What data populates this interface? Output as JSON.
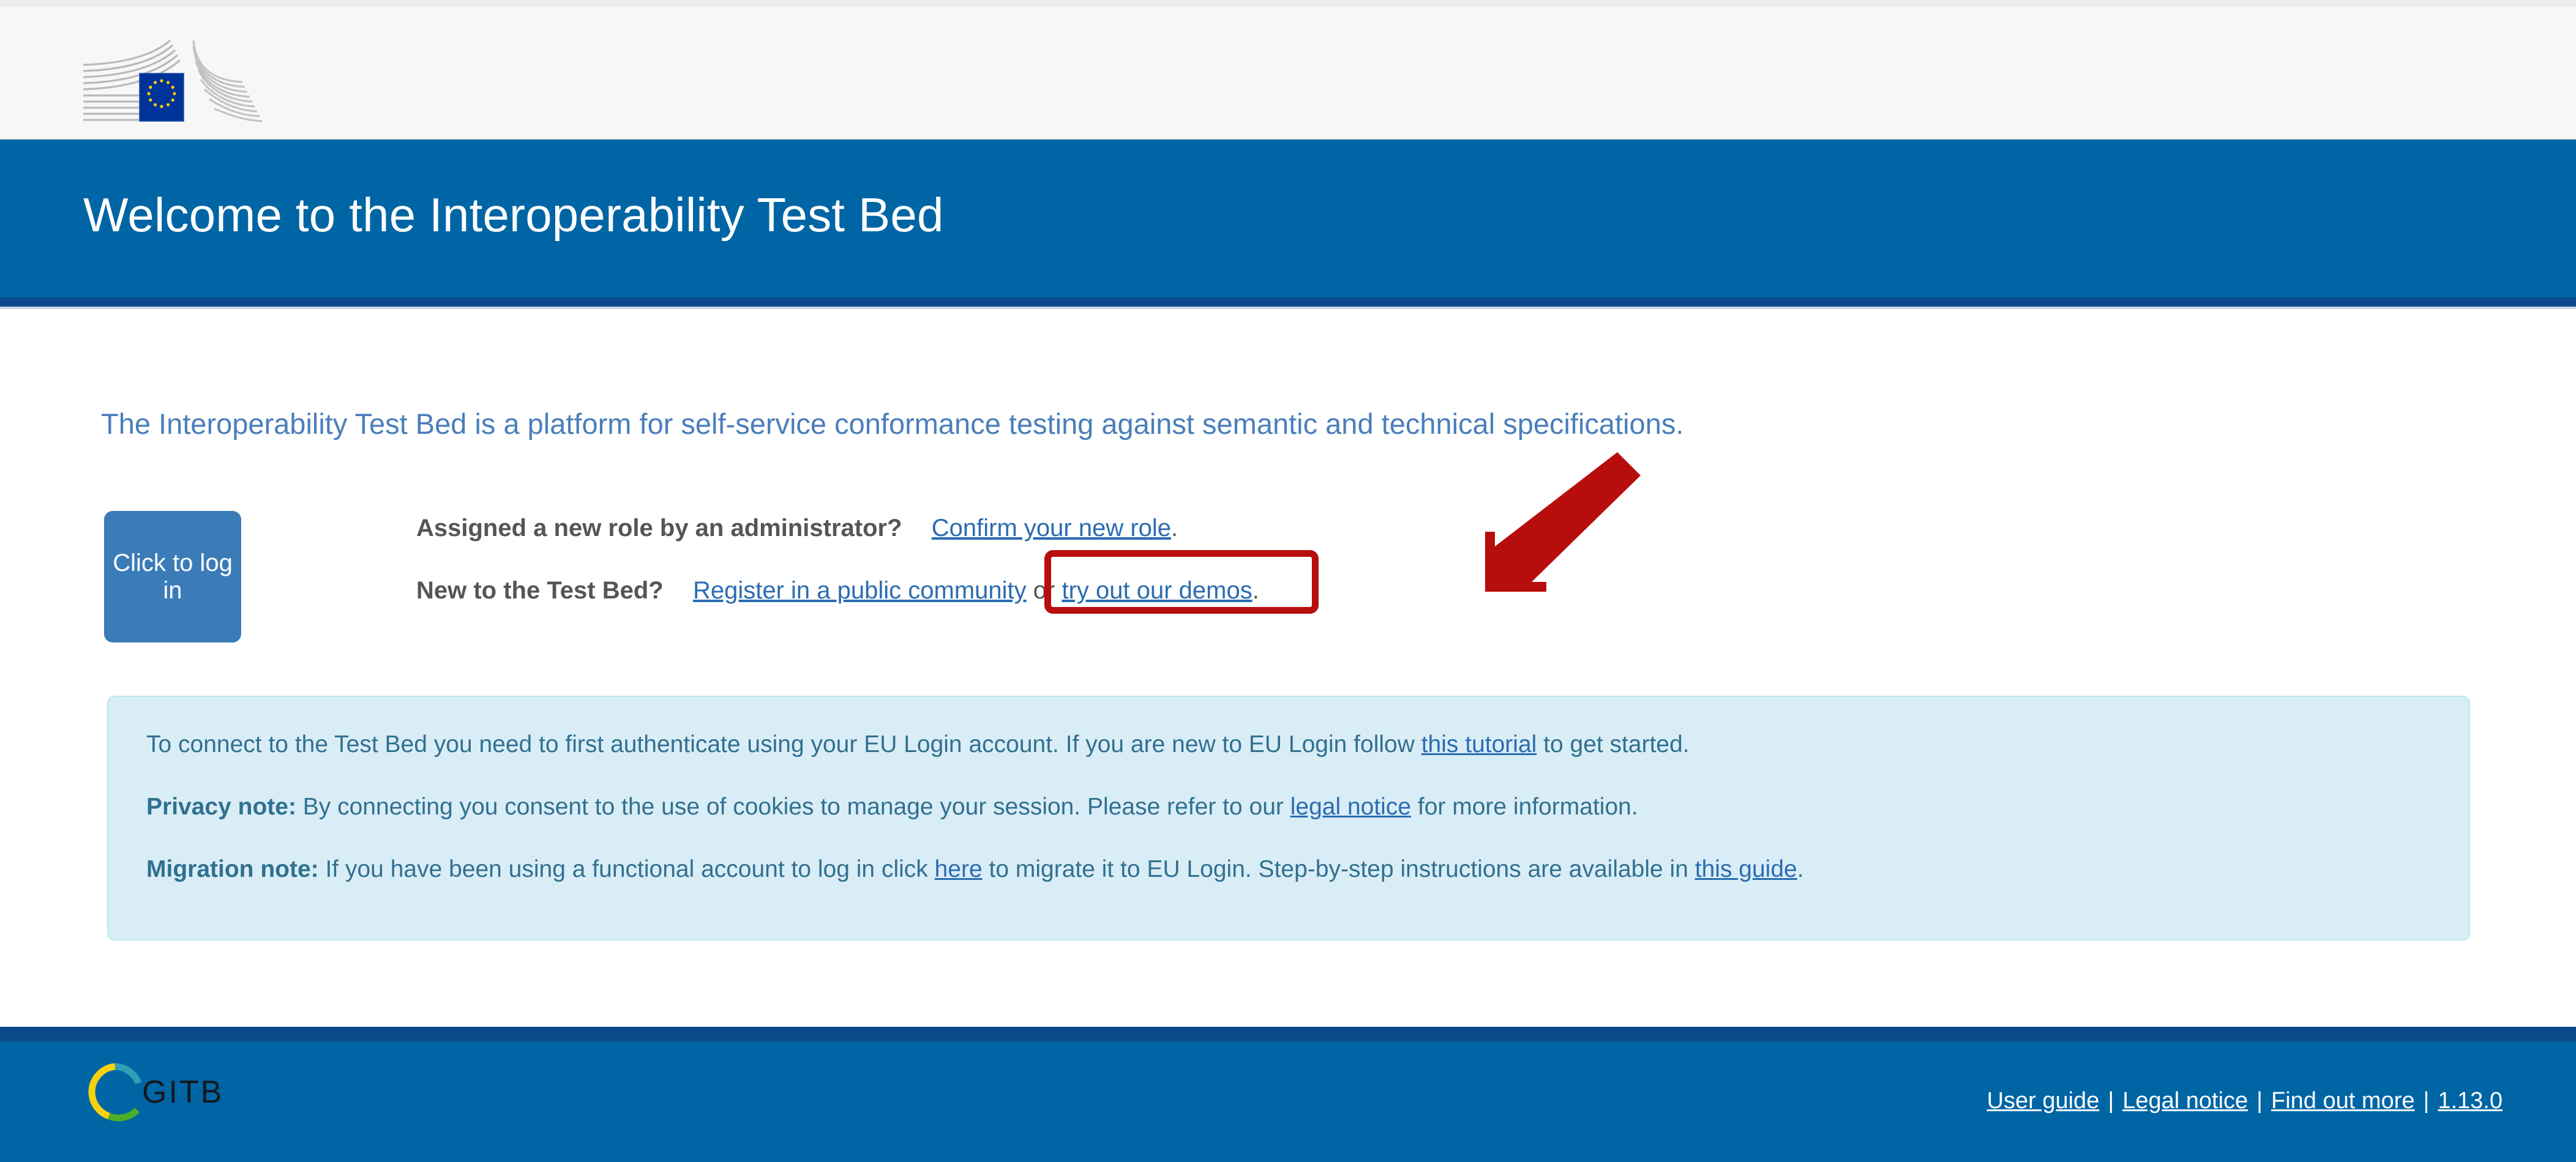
{
  "header": {
    "logo_alt": "European Commission",
    "banner_title": "Welcome to the Interoperability Test Bed"
  },
  "main": {
    "intro": "The Interoperability Test Bed is a platform for self-service conformance testing against semantic and technical specifications.",
    "login_button": "Click to log in",
    "role_prompt": {
      "label": "Assigned a new role by an administrator?",
      "link": "Confirm your new role",
      "suffix": "."
    },
    "new_user_prompt": {
      "label": "New to the Test Bed?",
      "link_register": "Register in a public community",
      "separator": " or ",
      "link_demos": "try out our demos",
      "suffix": "."
    },
    "info_panel": {
      "line1_before": "To connect to the Test Bed you need to first authenticate using your EU Login account. If you are new to EU Login follow ",
      "line1_link": "this tutorial",
      "line1_after": " to get started.",
      "line2_label": "Privacy note:",
      "line2_before": " By connecting you consent to the use of cookies to manage your session. Please refer to our ",
      "line2_link": "legal notice",
      "line2_after": " for more information.",
      "line3_label": "Migration note:",
      "line3_before": " If you have been using a functional account to log in click ",
      "line3_link": "here",
      "line3_mid": " to migrate it to EU Login. Step-by-step instructions are available in ",
      "line3_link2": "this guide",
      "line3_after": "."
    }
  },
  "annotations": {
    "highlight_target": "try out our demos",
    "arrow_color": "#b80d0d",
    "box_color": "#b80d0d"
  },
  "footer": {
    "logo_text": "GITB",
    "links": [
      {
        "label": "User guide"
      },
      {
        "label": "Legal notice"
      },
      {
        "label": "Find out more"
      },
      {
        "label": "1.13.0"
      }
    ],
    "separator": "|"
  },
  "colors": {
    "brand_blue": "#0065a4",
    "dark_blue": "#0a4a8a",
    "button_blue": "#3b7cb8",
    "intro_text": "#4a7ebb",
    "info_bg": "#d9edf7",
    "info_border": "#bce8f1",
    "info_text": "#31708f",
    "link": "#2b6cb0",
    "eu_flag_blue": "#003399",
    "eu_star_yellow": "#ffcc00",
    "gitb_yellow": "#f5d20c",
    "gitb_green": "#4caf2a",
    "gitb_teal": "#2e9fb5"
  }
}
